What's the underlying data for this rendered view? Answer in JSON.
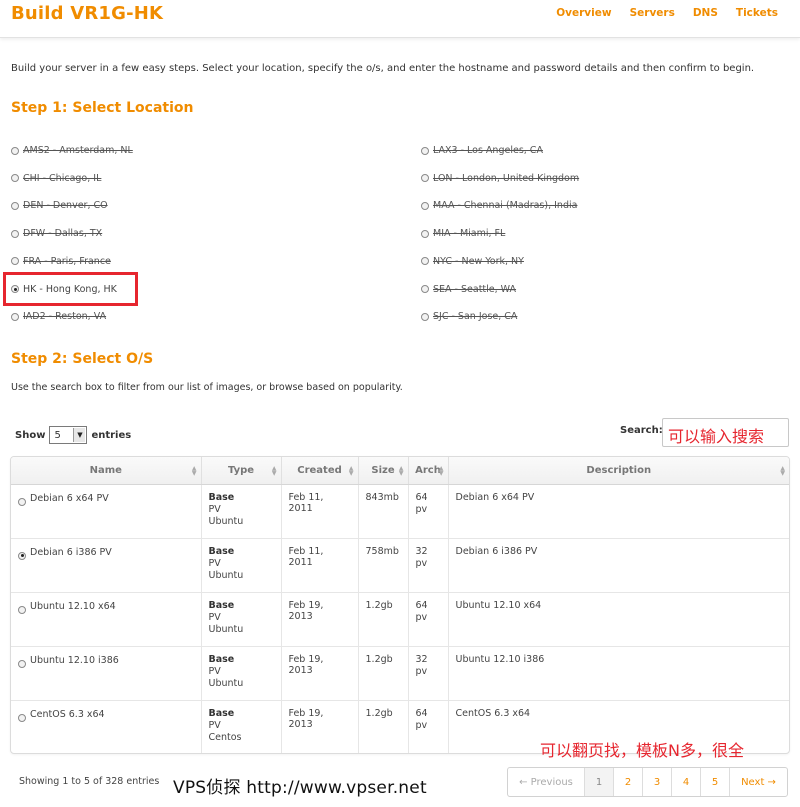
{
  "header": {
    "title": "Build VR1G-HK",
    "nav": [
      "Overview",
      "Servers",
      "DNS",
      "Tickets"
    ]
  },
  "intro": "Build your server in a few easy steps. Select your location, specify the o/s, and enter the hostname and password details and then confirm to begin.",
  "step1": {
    "title": "Step 1: Select Location",
    "left": [
      {
        "label": "AMS2 - Amsterdam, NL",
        "disabled": true
      },
      {
        "label": "CHI - Chicago, IL",
        "disabled": true
      },
      {
        "label": "DEN - Denver, CO",
        "disabled": true
      },
      {
        "label": "DFW - Dallas, TX",
        "disabled": true
      },
      {
        "label": "FRA - Paris, France",
        "disabled": true
      },
      {
        "label": "HK - Hong Kong, HK",
        "disabled": false,
        "selected": true
      },
      {
        "label": "IAD2 - Reston, VA",
        "disabled": true
      }
    ],
    "right": [
      {
        "label": "LAX3 - Los Angeles, CA",
        "disabled": true
      },
      {
        "label": "LON - London, United Kingdom",
        "disabled": true
      },
      {
        "label": "MAA - Chennai (Madras), India",
        "disabled": true
      },
      {
        "label": "MIA - Miami, FL",
        "disabled": true
      },
      {
        "label": "NYC - New York, NY",
        "disabled": true
      },
      {
        "label": "SEA - Seattle, WA",
        "disabled": true
      },
      {
        "label": "SJC - San Jose, CA",
        "disabled": true
      }
    ]
  },
  "step2": {
    "title": "Step 2: Select O/S",
    "hint": "Use the search box to filter from our list of images, or browse based on popularity.",
    "show_label": "Show",
    "show_value": "5",
    "entries_label": "entries",
    "search_label": "Search:",
    "search_value": "可以输入搜索"
  },
  "table": {
    "columns": [
      "Name",
      "Type",
      "Created",
      "Size",
      "Arch",
      "Description"
    ],
    "rows": [
      {
        "name": "Debian 6 x64 PV",
        "type": [
          "Base",
          "PV",
          "Ubuntu"
        ],
        "created": "Feb 11, 2011",
        "size": "843mb",
        "arch": [
          "64",
          "pv"
        ],
        "description": "Debian 6 x64 PV",
        "selected": false
      },
      {
        "name": "Debian 6 i386 PV",
        "type": [
          "Base",
          "PV",
          "Ubuntu"
        ],
        "created": "Feb 11, 2011",
        "size": "758mb",
        "arch": [
          "32",
          "pv"
        ],
        "description": "Debian 6 i386 PV",
        "selected": true
      },
      {
        "name": "Ubuntu 12.10 x64",
        "type": [
          "Base",
          "PV",
          "Ubuntu"
        ],
        "created": "Feb 19, 2013",
        "size": "1.2gb",
        "arch": [
          "64",
          "pv"
        ],
        "description": "Ubuntu 12.10 x64",
        "selected": false
      },
      {
        "name": "Ubuntu 12.10 i386",
        "type": [
          "Base",
          "PV",
          "Ubuntu"
        ],
        "created": "Feb 19, 2013",
        "size": "1.2gb",
        "arch": [
          "32",
          "pv"
        ],
        "description": "Ubuntu 12.10 i386",
        "selected": false
      },
      {
        "name": "CentOS 6.3 x64",
        "type": [
          "Base",
          "PV",
          "Centos"
        ],
        "created": "Feb 19, 2013",
        "size": "1.2gb",
        "arch": [
          "64",
          "pv"
        ],
        "description": "CentOS 6.3 x64",
        "selected": false
      }
    ]
  },
  "footer": {
    "showing": "Showing 1 to 5 of 328 entries",
    "watermark": "VPS侦探 http://www.vpser.net",
    "annotation": "可以翻页找，模板N多，很全",
    "pager": {
      "prev": "← Previous",
      "pages": [
        "1",
        "2",
        "3",
        "4",
        "5"
      ],
      "active": "1",
      "next": "Next →"
    }
  },
  "colors": {
    "accent": "#f08c00",
    "annotation_red": "#e6262f"
  }
}
